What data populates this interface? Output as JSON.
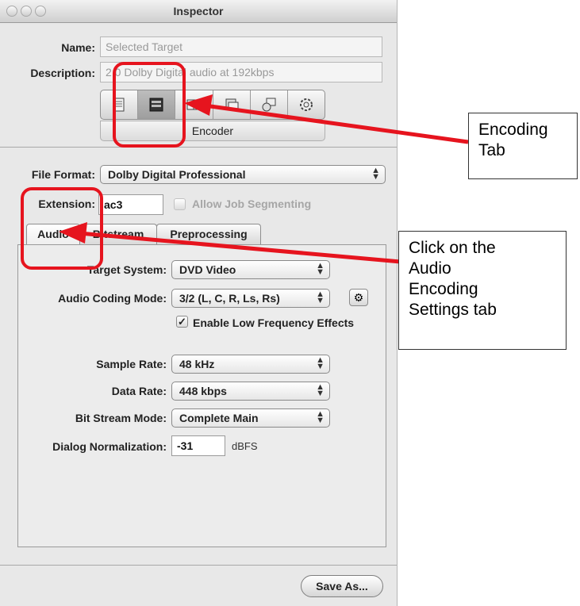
{
  "window": {
    "title": "Inspector"
  },
  "form": {
    "name_label": "Name:",
    "name_value": "Selected Target",
    "description_label": "Description:",
    "description_value": "2.0 Dolby Digital audio at 192kbps"
  },
  "toolbar": {
    "icons": [
      "summary-icon",
      "encoder-icon",
      "frame-controls-icon",
      "filters-icon",
      "geometry-icon",
      "actions-icon"
    ],
    "selected_label": "Encoder"
  },
  "encoder": {
    "file_format_label": "File Format:",
    "file_format_value": "Dolby Digital Professional",
    "extension_label": "Extension:",
    "extension_value": "ac3",
    "segmenting_label": "Allow Job Segmenting"
  },
  "tabs": [
    {
      "label": "Audio",
      "selected": true
    },
    {
      "label": "Bitstream",
      "selected": false
    },
    {
      "label": "Preprocessing",
      "selected": false
    }
  ],
  "audio": {
    "target_system_label": "Target System:",
    "target_system_value": "DVD Video",
    "coding_mode_label": "Audio Coding Mode:",
    "coding_mode_value": "3/2 (L, C, R, Ls, Rs)",
    "lfe_label": "Enable Low Frequency Effects",
    "lfe_checked": "✓",
    "sample_rate_label": "Sample Rate:",
    "sample_rate_value": "48 kHz",
    "data_rate_label": "Data Rate:",
    "data_rate_value": "448 kbps",
    "bitstream_mode_label": "Bit Stream Mode:",
    "bitstream_mode_value": "Complete Main",
    "dialnorm_label": "Dialog Normalization:",
    "dialnorm_value": "-31",
    "dialnorm_unit": "dBFS"
  },
  "footer": {
    "save_label": "Save As..."
  },
  "annotations": {
    "encoding_tab": "Encoding\nTab",
    "audio_tab": "Click on the\nAudio\nEncoding\nSettings tab",
    "highlight_color": "#e6141e"
  }
}
